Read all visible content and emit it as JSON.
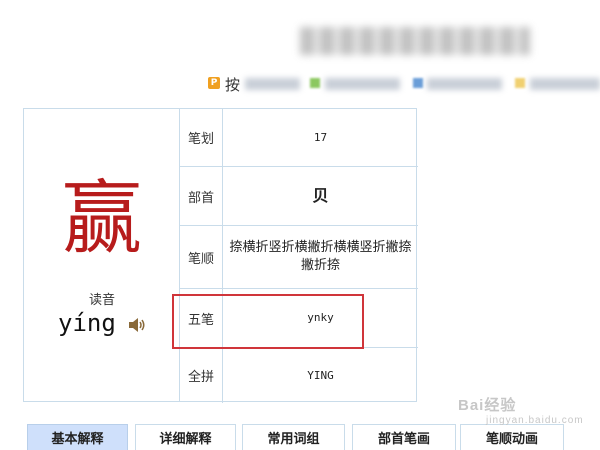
{
  "header": {
    "nav_badge": "P",
    "nav_prefix": "按"
  },
  "entry": {
    "character": "赢",
    "reading_label": "读音",
    "pinyin": "yíng",
    "rows": [
      {
        "label": "笔划",
        "value": "17"
      },
      {
        "label": "部首",
        "value": "贝"
      },
      {
        "label": "笔顺",
        "value": "捺横折竖折横撇折横横竖折撇捺撇折捺"
      },
      {
        "label": "五笔",
        "value": "ynky"
      },
      {
        "label": "全拼",
        "value": "YING"
      }
    ]
  },
  "tabs": [
    {
      "label": "基本解释"
    },
    {
      "label": "详细解释"
    },
    {
      "label": "常用词组"
    },
    {
      "label": "部首笔画"
    },
    {
      "label": "笔顺动画"
    }
  ],
  "watermark": {
    "text": "Bai经验",
    "sub": "jingyan.baidu.com"
  },
  "colors": {
    "character": "#b71c1c",
    "highlight": "#d0353a",
    "active_tab": "#cfe0fb",
    "border": "#c9dcea"
  }
}
